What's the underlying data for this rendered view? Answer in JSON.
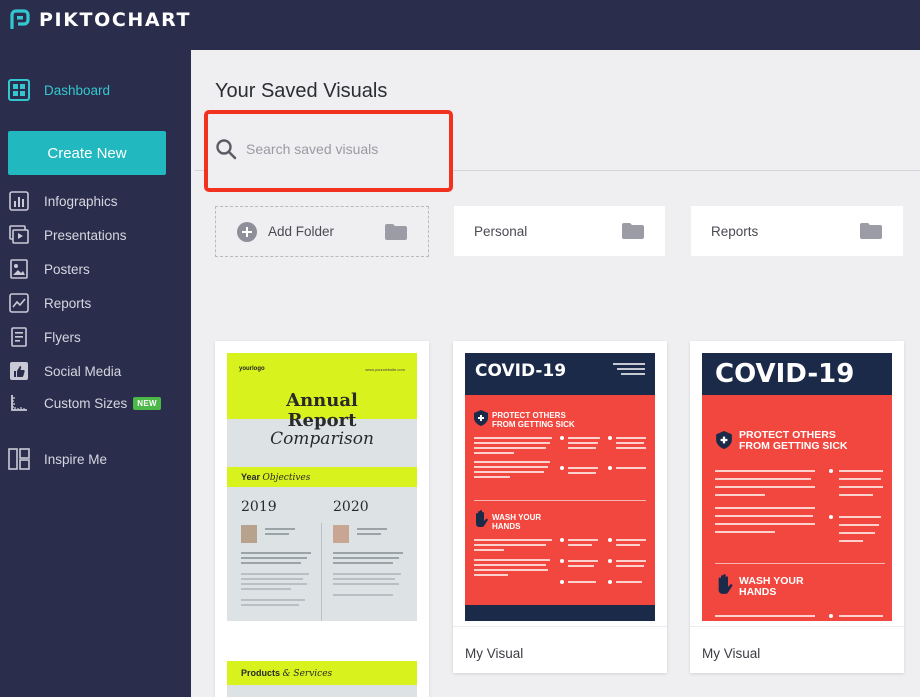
{
  "app": {
    "logo_text": "PIKTOCHART"
  },
  "sidebar": {
    "dashboard": "Dashboard",
    "create_new": "Create New",
    "items": [
      {
        "label": "Infographics",
        "icon": "bar-chart-icon"
      },
      {
        "label": "Presentations",
        "icon": "presentation-icon"
      },
      {
        "label": "Posters",
        "icon": "image-icon"
      },
      {
        "label": "Reports",
        "icon": "line-chart-icon"
      },
      {
        "label": "Flyers",
        "icon": "document-icon"
      },
      {
        "label": "Social Media",
        "icon": "thumbs-up-icon"
      },
      {
        "label": "Custom Sizes",
        "icon": "ruler-icon",
        "badge": "NEW"
      }
    ],
    "inspire": "Inspire Me"
  },
  "main": {
    "title": "Your Saved Visuals",
    "search_placeholder": "Search saved visuals",
    "folders": [
      {
        "label": "Add Folder"
      },
      {
        "label": "Personal"
      },
      {
        "label": "Reports"
      }
    ],
    "cards": [
      {
        "caption": ""
      },
      {
        "caption": "My Visual"
      },
      {
        "caption": "My Visual"
      }
    ]
  },
  "thumbs": {
    "annual": {
      "logo": "yourlogo",
      "title_line1": "Annual",
      "title_line2": "Report",
      "title_line3": "Comparison",
      "band1_bold": "Year",
      "band1_italic": "Objectives",
      "year_a": "2019",
      "year_b": "2020",
      "band2_bold": "Products",
      "band2_italic": "& Services"
    },
    "covid": {
      "title": "COVID-19",
      "section1": "PROTECT OTHERS\nFROM GETTING SICK",
      "section2": "WASH YOUR\nHANDS"
    }
  },
  "colors": {
    "sidebar_bg": "#2b2d4d",
    "accent_teal": "#21b8c0",
    "highlight_red": "#f2321f",
    "annual_lime": "#d7f21d",
    "covid_red": "#f2473f",
    "covid_navy": "#1c2a4a"
  }
}
